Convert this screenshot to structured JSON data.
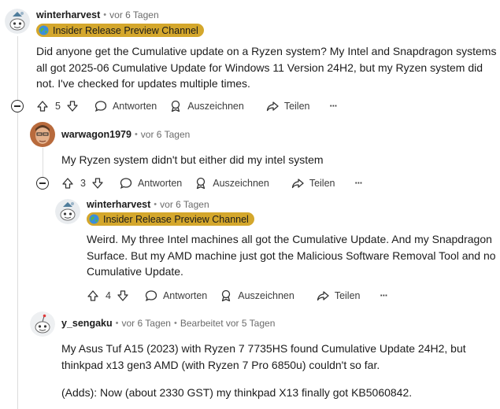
{
  "comments": [
    {
      "author": "winterharvest",
      "time": "vor 6 Tagen",
      "flair": "Insider Release Preview Channel",
      "body": "Did anyone get the Cumulative update on a Ryzen system? My Intel and Snapdragon systems all got 2025-06 Cumulative Update for Windows 11 Version 24H2, but my Ryzen system did not. I've checked for updates multiple times.",
      "votes": "5"
    },
    {
      "author": "warwagon1979",
      "time": "vor 6 Tagen",
      "body": "My Ryzen system didn't but either did my intel system",
      "votes": "3"
    },
    {
      "author": "winterharvest",
      "time": "vor 6 Tagen",
      "flair": "Insider Release Preview Channel",
      "body": "Weird. My three Intel machines all got the Cumulative Update. And my Snapdragon Surface. But my AMD machine just got the Malicious Software Removal Tool and no Cumulative Update.",
      "votes": "4"
    },
    {
      "author": "y_sengaku",
      "time": "vor 6 Tagen",
      "edited": "Bearbeitet vor 5 Tagen",
      "body": "My Asus Tuf A15 (2023) with Ryzen 7 7735HS found Cumulative Update 24H2, but thinkpad x13 gen3 AMD (with Ryzen 7 Pro 6850u) couldn't so far.",
      "body2": "(Adds): Now (about 2330 GST) my thinkpad X13 finally got KB5060842."
    }
  ],
  "actions": {
    "reply": "Antworten",
    "award": "Auszeichnen",
    "share": "Teilen",
    "more": "···"
  },
  "colors": {
    "flair_bg": "#d4a72c",
    "text": "#1c1c1c",
    "meta": "#6b6b6b"
  }
}
